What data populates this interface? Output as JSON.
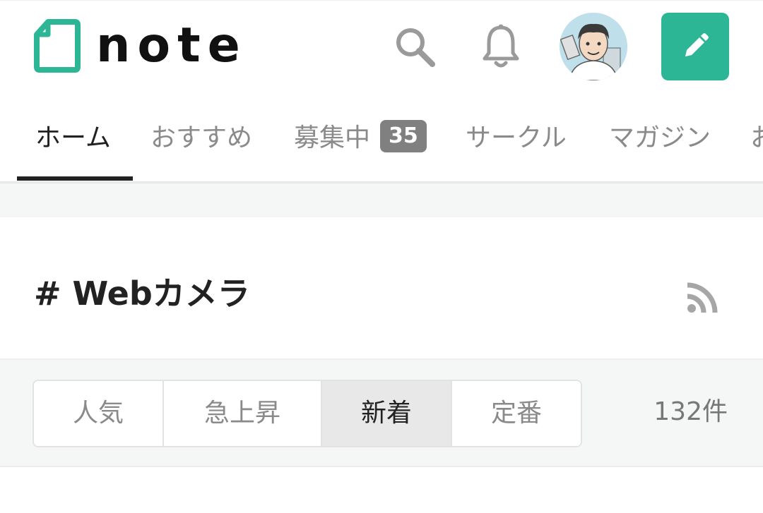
{
  "header": {
    "logo_text": "note",
    "search_label": "search",
    "notifications_label": "notifications",
    "post_label": "post"
  },
  "nav": {
    "tabs": [
      {
        "label": "ホーム",
        "active": true
      },
      {
        "label": "おすすめ",
        "active": false
      },
      {
        "label": "募集中",
        "badge": "35",
        "active": false
      },
      {
        "label": "サークル",
        "active": false
      },
      {
        "label": "マガジン",
        "active": false
      },
      {
        "label": "お",
        "active": false
      }
    ]
  },
  "hashtag": {
    "title": "# Webカメラ"
  },
  "sort": {
    "options": [
      {
        "label": "人気",
        "selected": false
      },
      {
        "label": "急上昇",
        "selected": false
      },
      {
        "label": "新着",
        "selected": true
      },
      {
        "label": "定番",
        "selected": false
      }
    ],
    "count": "132件"
  },
  "colors": {
    "brand": "#2cb696",
    "text": "#222222",
    "muted": "#8a8a8a",
    "badge": "#808080",
    "background_gray": "#f5f6f6"
  },
  "icons": {
    "search": "search-icon",
    "bell": "bell-icon",
    "pencil": "pencil-icon",
    "rss": "rss-icon",
    "logo": "note-logo-icon"
  }
}
